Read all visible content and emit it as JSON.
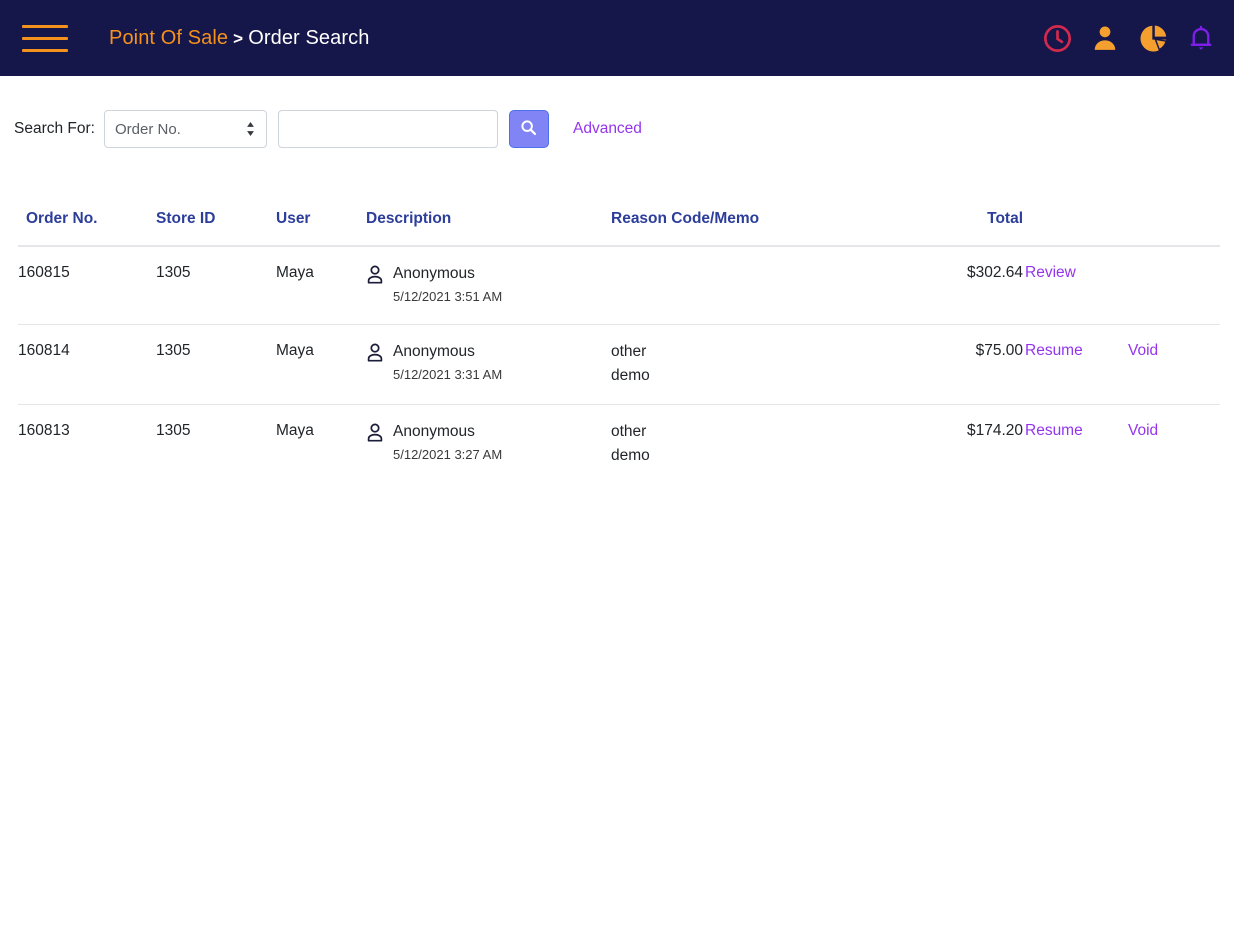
{
  "header": {
    "menu_icon": "hamburger-icon",
    "app_name": "Point Of Sale",
    "separator": ">",
    "page_title": "Order Search",
    "icons": [
      {
        "name": "clock-icon",
        "color": "#d22a4e"
      },
      {
        "name": "user-icon",
        "color": "#f5a02e"
      },
      {
        "name": "pie-chart-icon",
        "color": "#f5a02e"
      },
      {
        "name": "bell-icon",
        "color": "#7d1fe8"
      }
    ],
    "bar_color": "#15164a",
    "accent_color": "#f5921e"
  },
  "search": {
    "label": "Search For:",
    "select_value": "Order No.",
    "select_options": [
      "Order No."
    ],
    "input_value": "",
    "input_placeholder": "",
    "search_button_icon": "search-icon",
    "search_button_color": "#8084f4",
    "advanced_label": "Advanced",
    "link_color": "#9435ec"
  },
  "table": {
    "columns": [
      "Order No.",
      "Store ID",
      "User",
      "Description",
      "Reason Code/Memo",
      "Total",
      "",
      ""
    ],
    "header_color": "#2c3e9a",
    "rows": [
      {
        "order_no": "160815",
        "store_id": "1305",
        "user": "Maya",
        "customer_icon": "person-icon",
        "customer": "Anonymous",
        "datetime": "5/12/2021 3:51 AM",
        "reason_line1": "",
        "reason_line2": "",
        "total": "$302.64",
        "action1": "Review",
        "action2": ""
      },
      {
        "order_no": "160814",
        "store_id": "1305",
        "user": "Maya",
        "customer_icon": "person-icon",
        "customer": "Anonymous",
        "datetime": "5/12/2021 3:31 AM",
        "reason_line1": "other",
        "reason_line2": "demo",
        "total": "$75.00",
        "action1": "Resume",
        "action2": "Void"
      },
      {
        "order_no": "160813",
        "store_id": "1305",
        "user": "Maya",
        "customer_icon": "person-icon",
        "customer": "Anonymous",
        "datetime": "5/12/2021 3:27 AM",
        "reason_line1": "other",
        "reason_line2": "demo",
        "total": "$174.20",
        "action1": "Resume",
        "action2": "Void"
      }
    ]
  }
}
